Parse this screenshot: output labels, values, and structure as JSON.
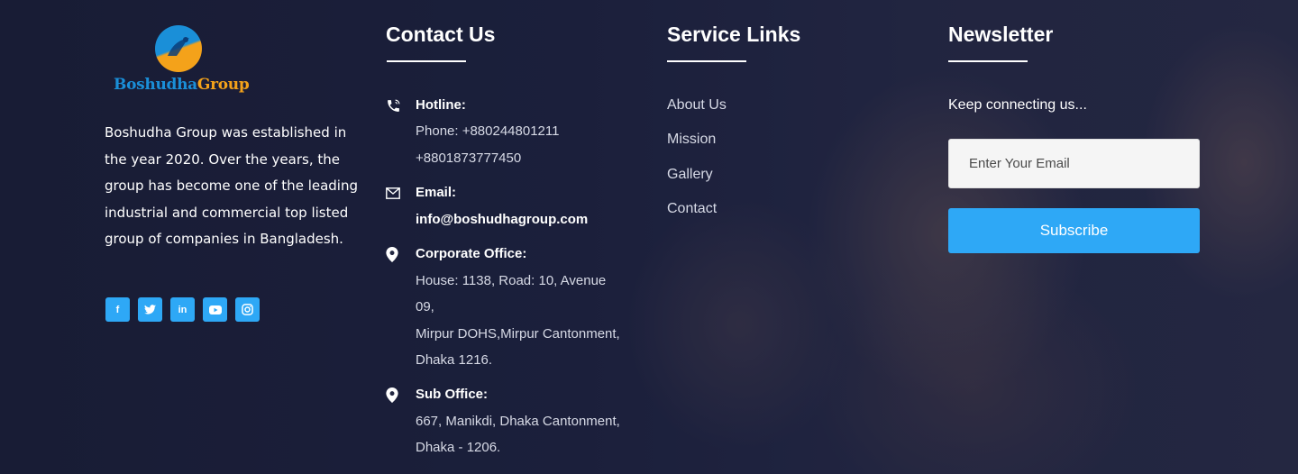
{
  "brand": {
    "logo_part1": "Boshudha",
    "logo_part2": "Group",
    "description": "Boshudha Group was established in the year 2020. Over the years, the group has become one of the leading industrial and commercial top listed group of companies in Bangladesh."
  },
  "social": [
    {
      "icon": "facebook-icon",
      "glyph": "f"
    },
    {
      "icon": "twitter-icon",
      "glyph": "t"
    },
    {
      "icon": "linkedin-icon",
      "glyph": "in"
    },
    {
      "icon": "youtube-icon",
      "glyph": "▶"
    },
    {
      "icon": "instagram-icon",
      "glyph": "◎"
    }
  ],
  "contact": {
    "heading": "Contact Us",
    "hotline_title": "Hotline:",
    "hotline_phone": "Phone: +880244801211",
    "hotline_phone2": "+8801873777450",
    "email_title": "Email:",
    "email_value": "info@boshudhagroup.com",
    "corporate_title": "Corporate Office:",
    "corporate_line1": "House: 1138, Road: 10, Avenue",
    "corporate_line2": "09,",
    "corporate_line3": "Mirpur DOHS,Mirpur Cantonment,",
    "corporate_line4": "Dhaka 1216.",
    "sub_title": "Sub Office:",
    "sub_line1": "667, Manikdi, Dhaka Cantonment,",
    "sub_line2": "Dhaka - 1206."
  },
  "service": {
    "heading": "Service Links",
    "links": [
      "About Us",
      "Mission",
      "Gallery",
      "Contact"
    ]
  },
  "newsletter": {
    "heading": "Newsletter",
    "text": "Keep connecting us...",
    "placeholder": "Enter Your Email",
    "button": "Subscribe"
  },
  "colors": {
    "accent": "#2ea8f6",
    "logo_blue": "#1a8fd8",
    "logo_orange": "#f4a21a"
  }
}
